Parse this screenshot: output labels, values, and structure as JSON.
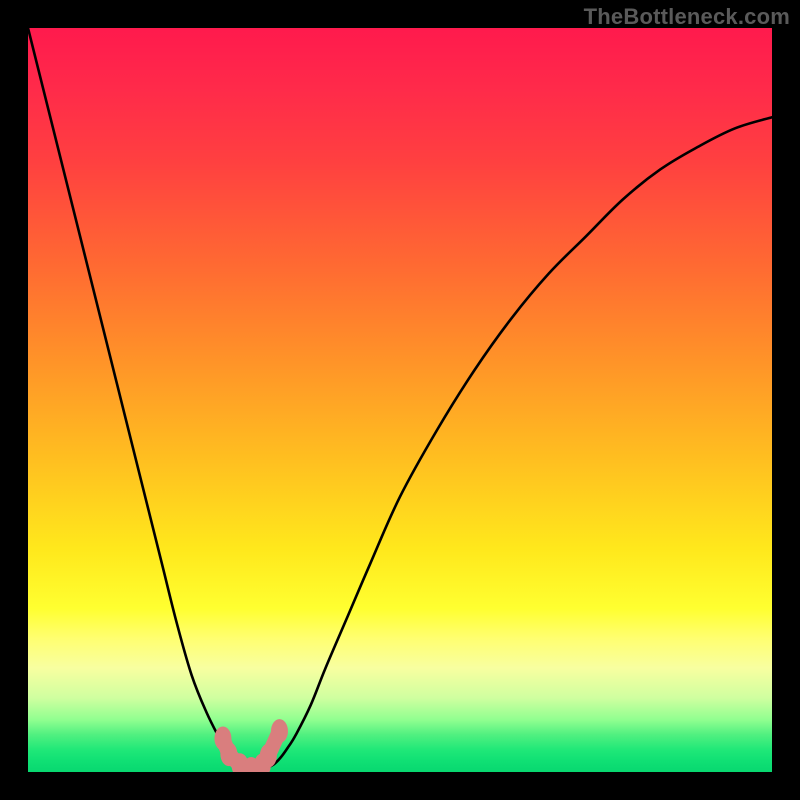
{
  "attribution": "TheBottleneck.com",
  "colors": {
    "curve": "#000000",
    "marker": "#d97e7e",
    "gradient_top": "#ff1a4d",
    "gradient_bottom": "#08d870"
  },
  "chart_data": {
    "type": "line",
    "title": "",
    "xlabel": "",
    "ylabel": "",
    "x_range": [
      0,
      100
    ],
    "y_range": [
      0,
      100
    ],
    "x": [
      0,
      2,
      4,
      6,
      8,
      10,
      12,
      14,
      16,
      18,
      20,
      22,
      24,
      26,
      27,
      28,
      29,
      30,
      31,
      32,
      33,
      34,
      35,
      36,
      38,
      40,
      43,
      46,
      50,
      55,
      60,
      65,
      70,
      75,
      80,
      85,
      90,
      95,
      100
    ],
    "y": [
      100,
      92,
      84,
      76,
      68,
      60,
      52,
      44,
      36,
      28,
      20,
      13,
      8,
      4,
      2,
      1,
      0.6,
      0.4,
      0.4,
      0.6,
      1,
      2,
      3.4,
      5,
      9,
      14,
      21,
      28,
      37,
      46,
      54,
      61,
      67,
      72,
      77,
      81,
      84,
      86.5,
      88
    ],
    "optimum_x": 30,
    "description": "V-shaped bottleneck curve: left branch descends steeply from 100 at x=0 to a minimum near 0 around x≈30, right branch rises with diminishing slope toward ~88 at x=100.",
    "highlight_markers": [
      {
        "x": 26.2,
        "y": 4.5
      },
      {
        "x": 27.0,
        "y": 2.4
      },
      {
        "x": 28.5,
        "y": 0.9
      },
      {
        "x": 30.0,
        "y": 0.4
      },
      {
        "x": 31.5,
        "y": 0.9
      },
      {
        "x": 32.3,
        "y": 2.2
      },
      {
        "x": 33.8,
        "y": 5.5
      }
    ]
  }
}
